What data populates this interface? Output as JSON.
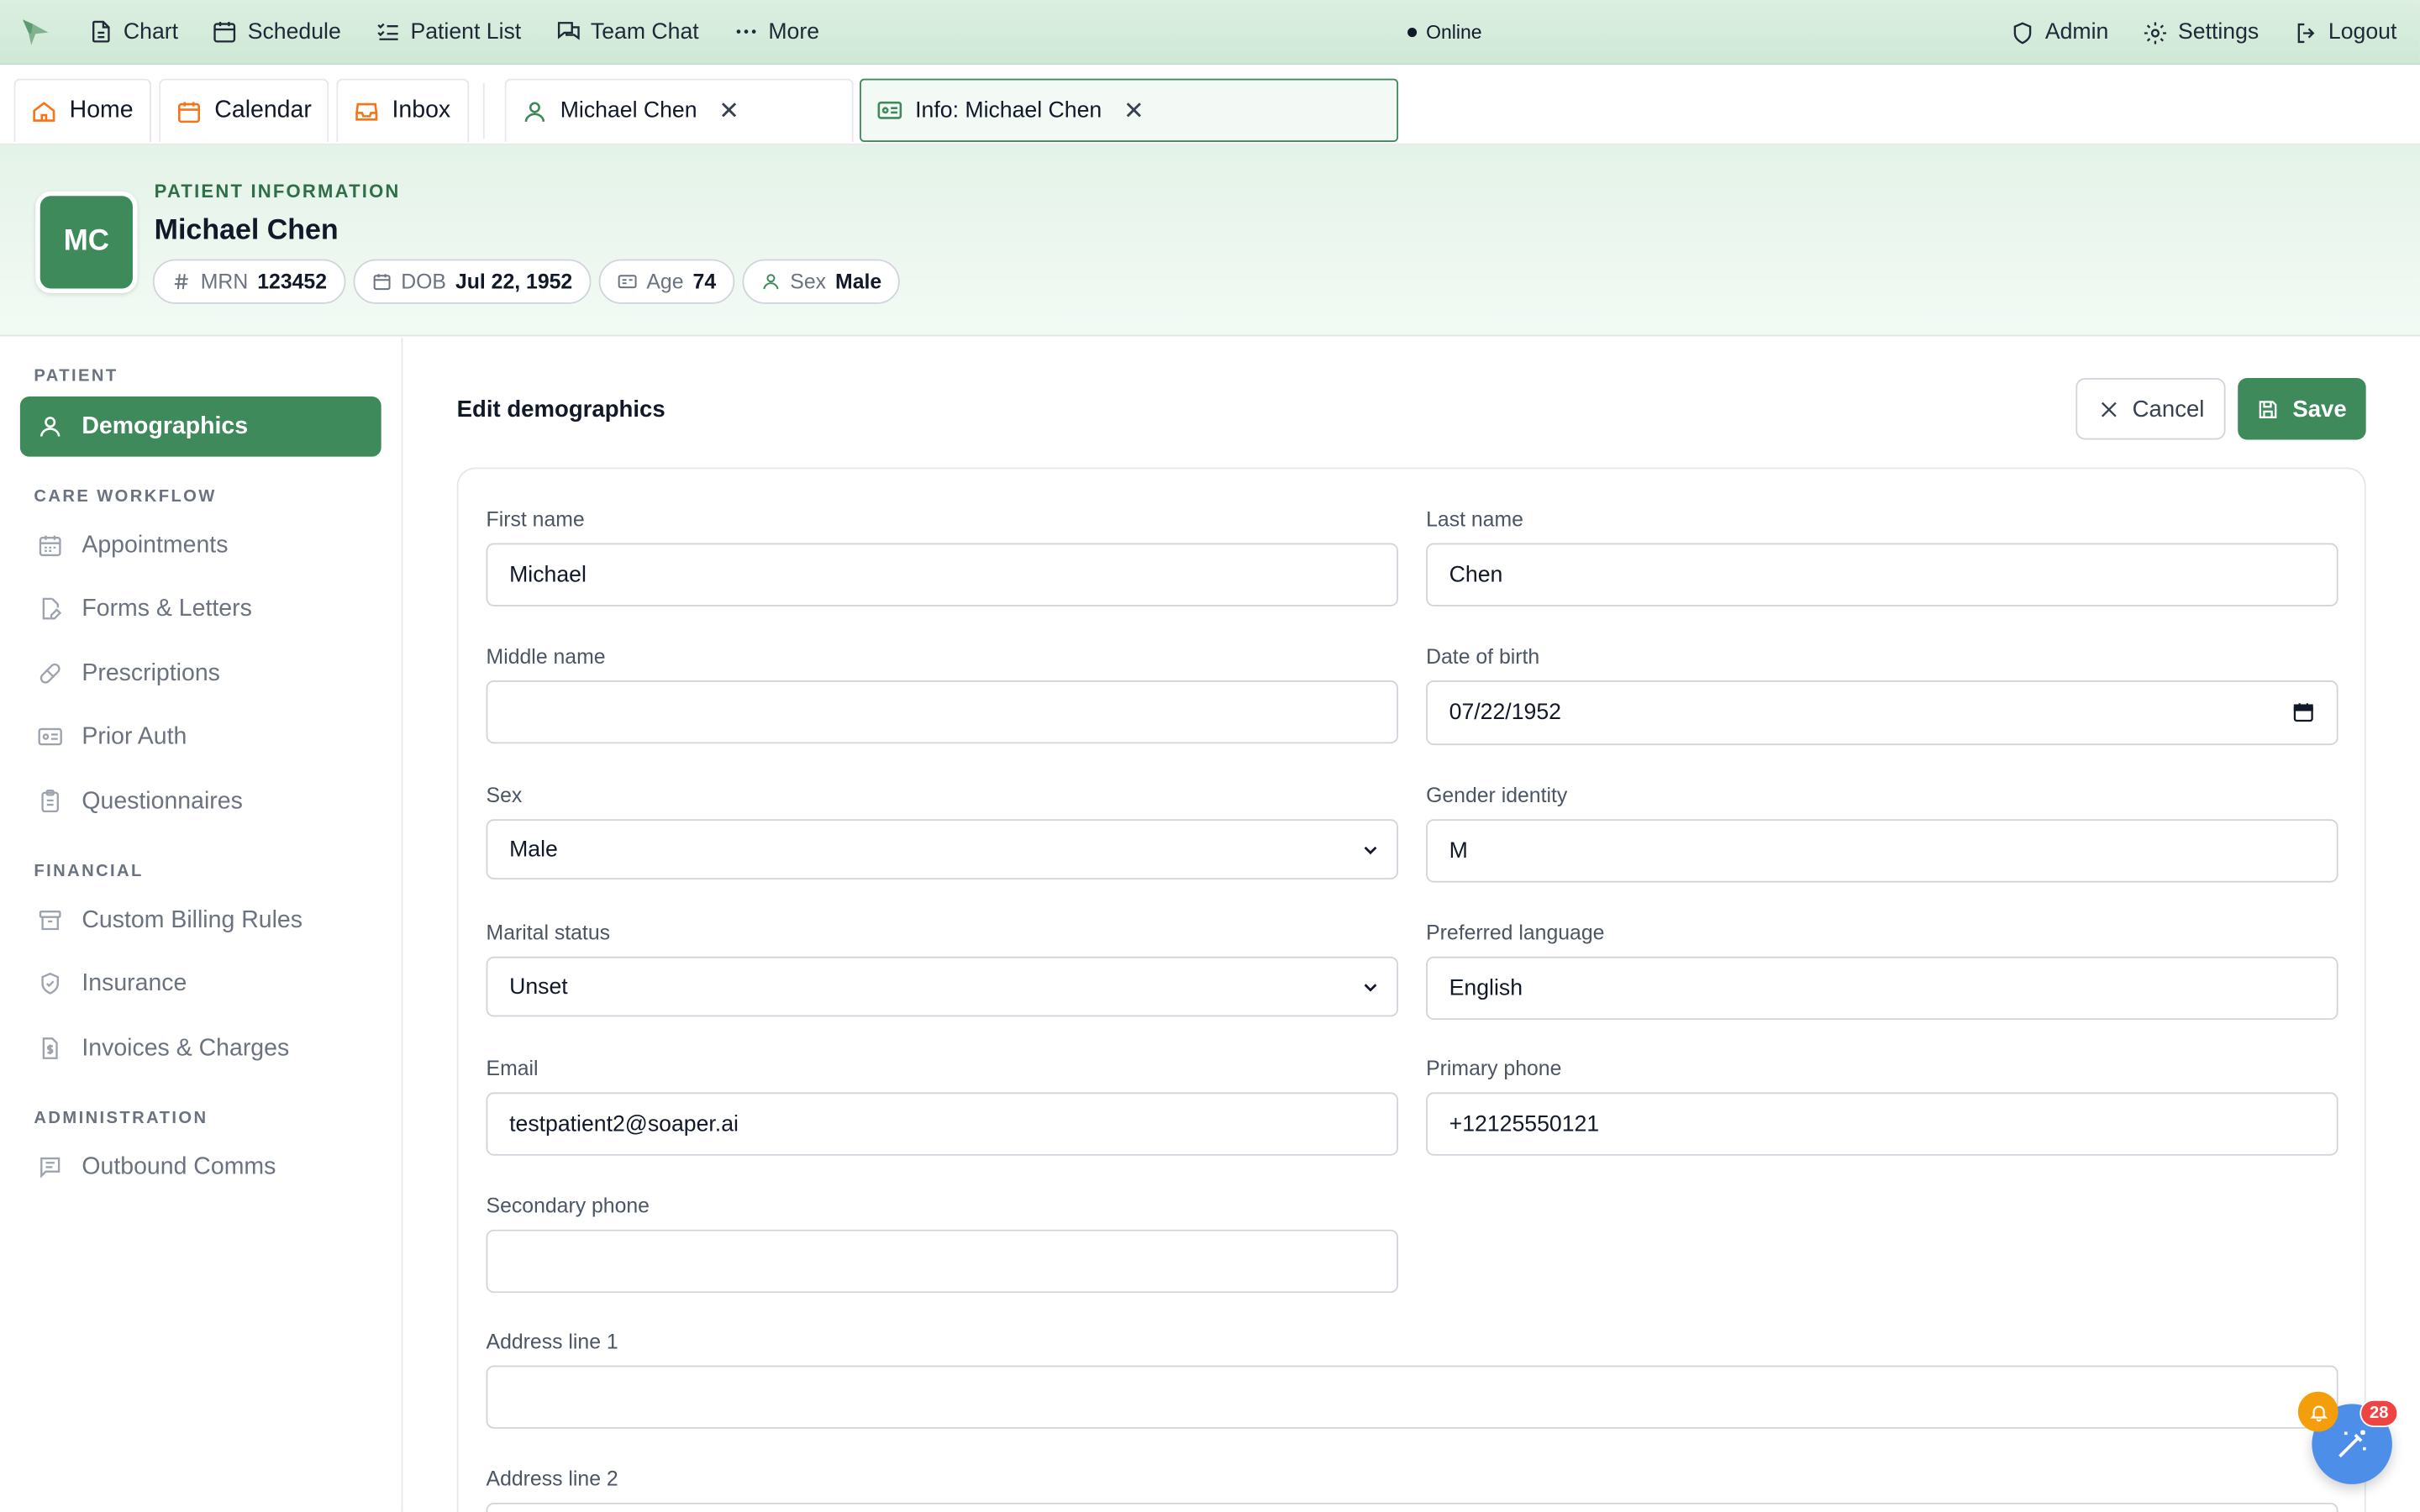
{
  "topnav": {
    "items": [
      {
        "label": "Chart",
        "icon": "document-icon"
      },
      {
        "label": "Schedule",
        "icon": "calendar-icon"
      },
      {
        "label": "Patient List",
        "icon": "list-icon"
      },
      {
        "label": "Team Chat",
        "icon": "chat-icon"
      },
      {
        "label": "More",
        "icon": "more-icon"
      }
    ],
    "status": "Online",
    "right": [
      {
        "label": "Admin",
        "icon": "shield-icon"
      },
      {
        "label": "Settings",
        "icon": "gear-icon"
      },
      {
        "label": "Logout",
        "icon": "logout-icon"
      }
    ]
  },
  "tabs": {
    "home": "Home",
    "calendar": "Calendar",
    "inbox": "Inbox",
    "patient": "Michael Chen",
    "info": "Info: Michael Chen"
  },
  "patient": {
    "section_label": "PATIENT INFORMATION",
    "initials": "MC",
    "name": "Michael Chen",
    "mrn_label": "MRN",
    "mrn": "123452",
    "dob_label": "DOB",
    "dob": "Jul 22, 1952",
    "age_label": "Age",
    "age": "74",
    "sex_label": "Sex",
    "sex": "Male"
  },
  "sidebar": {
    "sections": [
      "PATIENT",
      "CARE WORKFLOW",
      "FINANCIAL",
      "ADMINISTRATION"
    ],
    "items": [
      {
        "label": "Demographics",
        "active": true
      },
      {
        "label": "Appointments"
      },
      {
        "label": "Forms & Letters"
      },
      {
        "label": "Prescriptions"
      },
      {
        "label": "Prior Auth"
      },
      {
        "label": "Questionnaires"
      },
      {
        "label": "Custom Billing Rules"
      },
      {
        "label": "Insurance"
      },
      {
        "label": "Invoices & Charges"
      },
      {
        "label": "Outbound Comms"
      }
    ]
  },
  "form": {
    "title": "Edit demographics",
    "cancel_label": "Cancel",
    "save_label": "Save",
    "fields": {
      "first_name": {
        "label": "First name",
        "value": "Michael"
      },
      "last_name": {
        "label": "Last name",
        "value": "Chen"
      },
      "middle_name": {
        "label": "Middle name",
        "value": ""
      },
      "dob": {
        "label": "Date of birth",
        "value": "07/22/1952"
      },
      "sex": {
        "label": "Sex",
        "value": "Male"
      },
      "gender_identity": {
        "label": "Gender identity",
        "value": "M"
      },
      "marital_status": {
        "label": "Marital status",
        "value": "Unset"
      },
      "preferred_language": {
        "label": "Preferred language",
        "value": "English"
      },
      "email": {
        "label": "Email",
        "value": "testpatient2@soaper.ai"
      },
      "primary_phone": {
        "label": "Primary phone",
        "value": "+12125550121"
      },
      "secondary_phone": {
        "label": "Secondary phone",
        "value": ""
      },
      "address1": {
        "label": "Address line 1",
        "value": ""
      },
      "address2": {
        "label": "Address line 2",
        "value": ""
      }
    }
  },
  "notifications": {
    "count": "28"
  },
  "colors": {
    "accent": "#3f8a5a",
    "nav_bg": "#dcefe1",
    "fab": "#4c8ee8",
    "badge": "#ef4444",
    "bell": "#f59e0b"
  }
}
